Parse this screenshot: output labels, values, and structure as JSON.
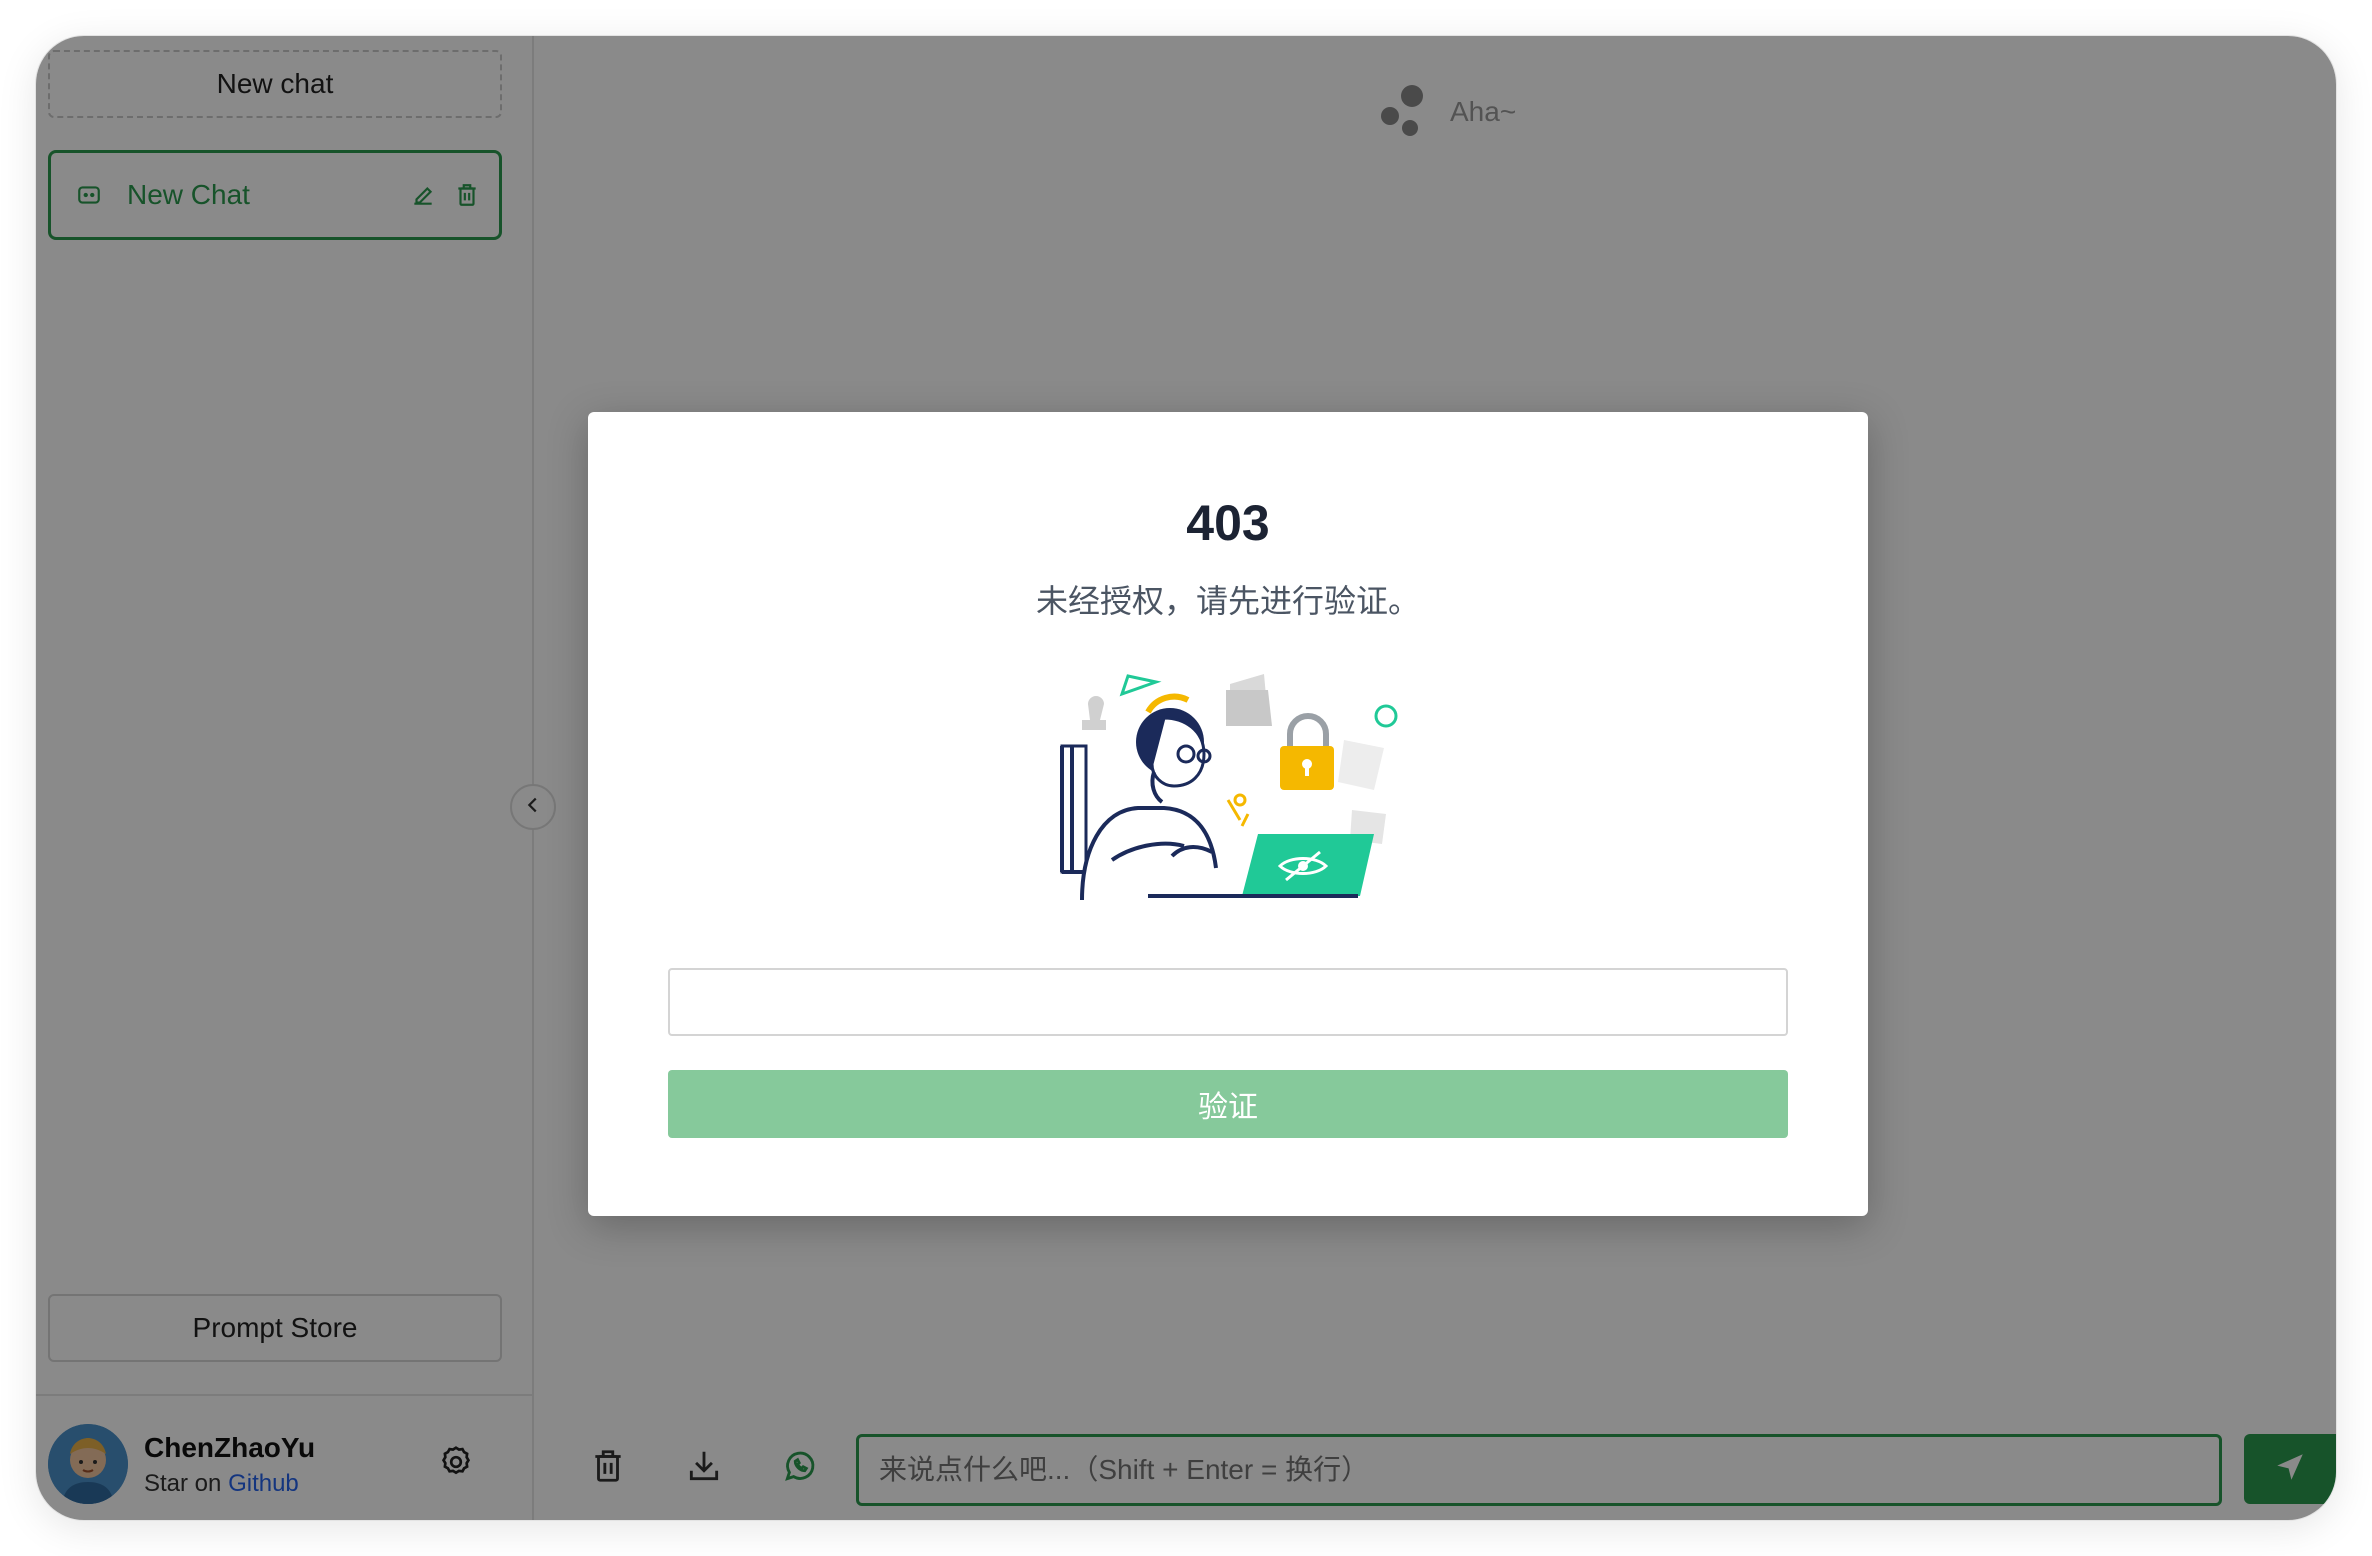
{
  "sidebar": {
    "new_chat_label": "New chat",
    "chats": [
      {
        "label": "New Chat"
      }
    ],
    "prompt_store_label": "Prompt Store",
    "user": {
      "name": "ChenZhaoYu",
      "star_prefix": "Star on",
      "star_link": "Github"
    }
  },
  "header": {
    "brand_name": "Aha~"
  },
  "footer": {
    "input_placeholder": "来说点什么吧...（Shift + Enter = 换行）"
  },
  "modal": {
    "code": "403",
    "message": "未经授权，请先进行验证。",
    "input_value": "",
    "verify_label": "验证"
  },
  "colors": {
    "accent": "#2b9a4f",
    "accent_disabled": "#86c99b",
    "link": "#2563eb"
  },
  "icons": [
    "chat-bubble-icon",
    "edit-icon",
    "trash-icon",
    "gear-icon",
    "chevron-left-icon",
    "download-icon",
    "whatsapp-icon",
    "send-icon"
  ]
}
